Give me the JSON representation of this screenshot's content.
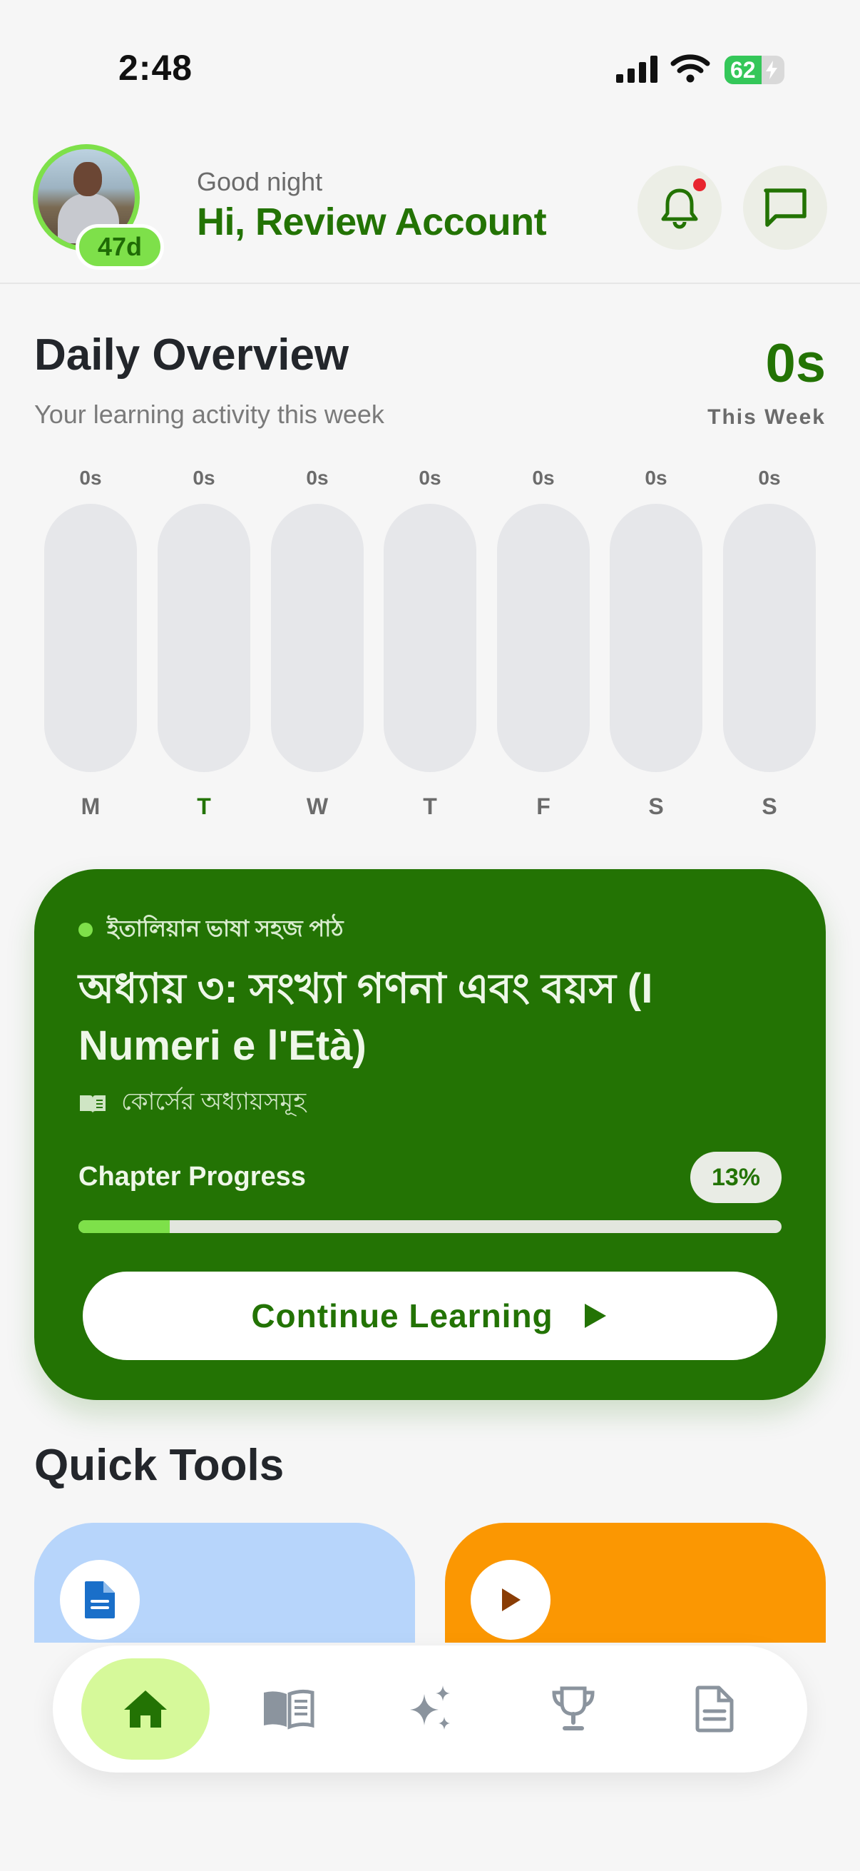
{
  "status_bar": {
    "time": "2:48",
    "battery": "62"
  },
  "header": {
    "streak": "47d",
    "greeting": "Good night",
    "user_name": "Hi, Review Account"
  },
  "overview": {
    "title": "Daily Overview",
    "subtitle": "Your learning activity this week",
    "total": "0s",
    "total_label": "This Week",
    "days": [
      {
        "day": "M",
        "value": "0s",
        "fill": 0
      },
      {
        "day": "T",
        "value": "0s",
        "fill": 0
      },
      {
        "day": "W",
        "value": "0s",
        "fill": 0
      },
      {
        "day": "T",
        "value": "0s",
        "fill": 0
      },
      {
        "day": "F",
        "value": "0s",
        "fill": 0
      },
      {
        "day": "S",
        "value": "0s",
        "fill": 0
      },
      {
        "day": "S",
        "value": "0s",
        "fill": 0
      }
    ]
  },
  "course": {
    "tag": "ইতালিয়ান ভাষা সহজ পাঠ",
    "chapter_title": "অধ্যায় ৩: সংখ্যা গণনা এবং বয়স (I Numeri e l'Età)",
    "subtitle": "কোর্সের অধ্যায়সমূহ",
    "progress_label": "Chapter Progress",
    "progress_text": "13%",
    "progress": 0.13,
    "button_label": "Continue Learning"
  },
  "quick_tools": {
    "title": "Quick Tools",
    "cards": [
      {
        "icon": "document-icon",
        "color": "#b7d5fb"
      },
      {
        "icon": "play-icon",
        "color": "#fb9702"
      }
    ]
  },
  "nav": {
    "items": [
      {
        "icon": "home-icon",
        "active": true
      },
      {
        "icon": "book-icon",
        "active": false
      },
      {
        "icon": "sparkles-icon",
        "active": false
      },
      {
        "icon": "trophy-icon",
        "active": false
      },
      {
        "icon": "document-icon",
        "active": false
      }
    ]
  },
  "colors": {
    "primary": "#237304",
    "accent": "#7ee04a",
    "notification": "#e8252e"
  }
}
